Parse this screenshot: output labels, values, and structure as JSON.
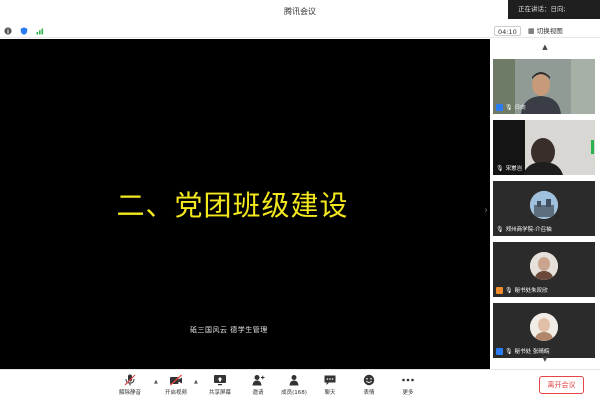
{
  "window": {
    "title": "腾讯会议"
  },
  "speaking": {
    "text": "正在讲话：日向;"
  },
  "infobar": {
    "timer": "04:10",
    "switch_view": "切换视图"
  },
  "slide": {
    "title": "二、党团班级建设",
    "footer": "砥三国风云   德学生管理"
  },
  "participants": [
    {
      "name": "日向",
      "tile": "video"
    },
    {
      "name": "宋崽岂",
      "tile": "video"
    },
    {
      "name": "郑州商学院-介召袖",
      "tile": "avatar"
    },
    {
      "name": "秘书处朱叹欣",
      "tile": "avatar"
    },
    {
      "name": "秘书处 张晴皖",
      "tile": "avatar"
    }
  ],
  "toolbar": {
    "mute": "解除静音",
    "video": "开启视频",
    "share": "共享屏幕",
    "invite": "邀请",
    "members": "成员(168)",
    "chat": "聊天",
    "reactions": "表情",
    "more": "更多",
    "end": "离开会议"
  },
  "colors": {
    "slide_title": "#f3e81e",
    "end_button": "#e54545"
  }
}
